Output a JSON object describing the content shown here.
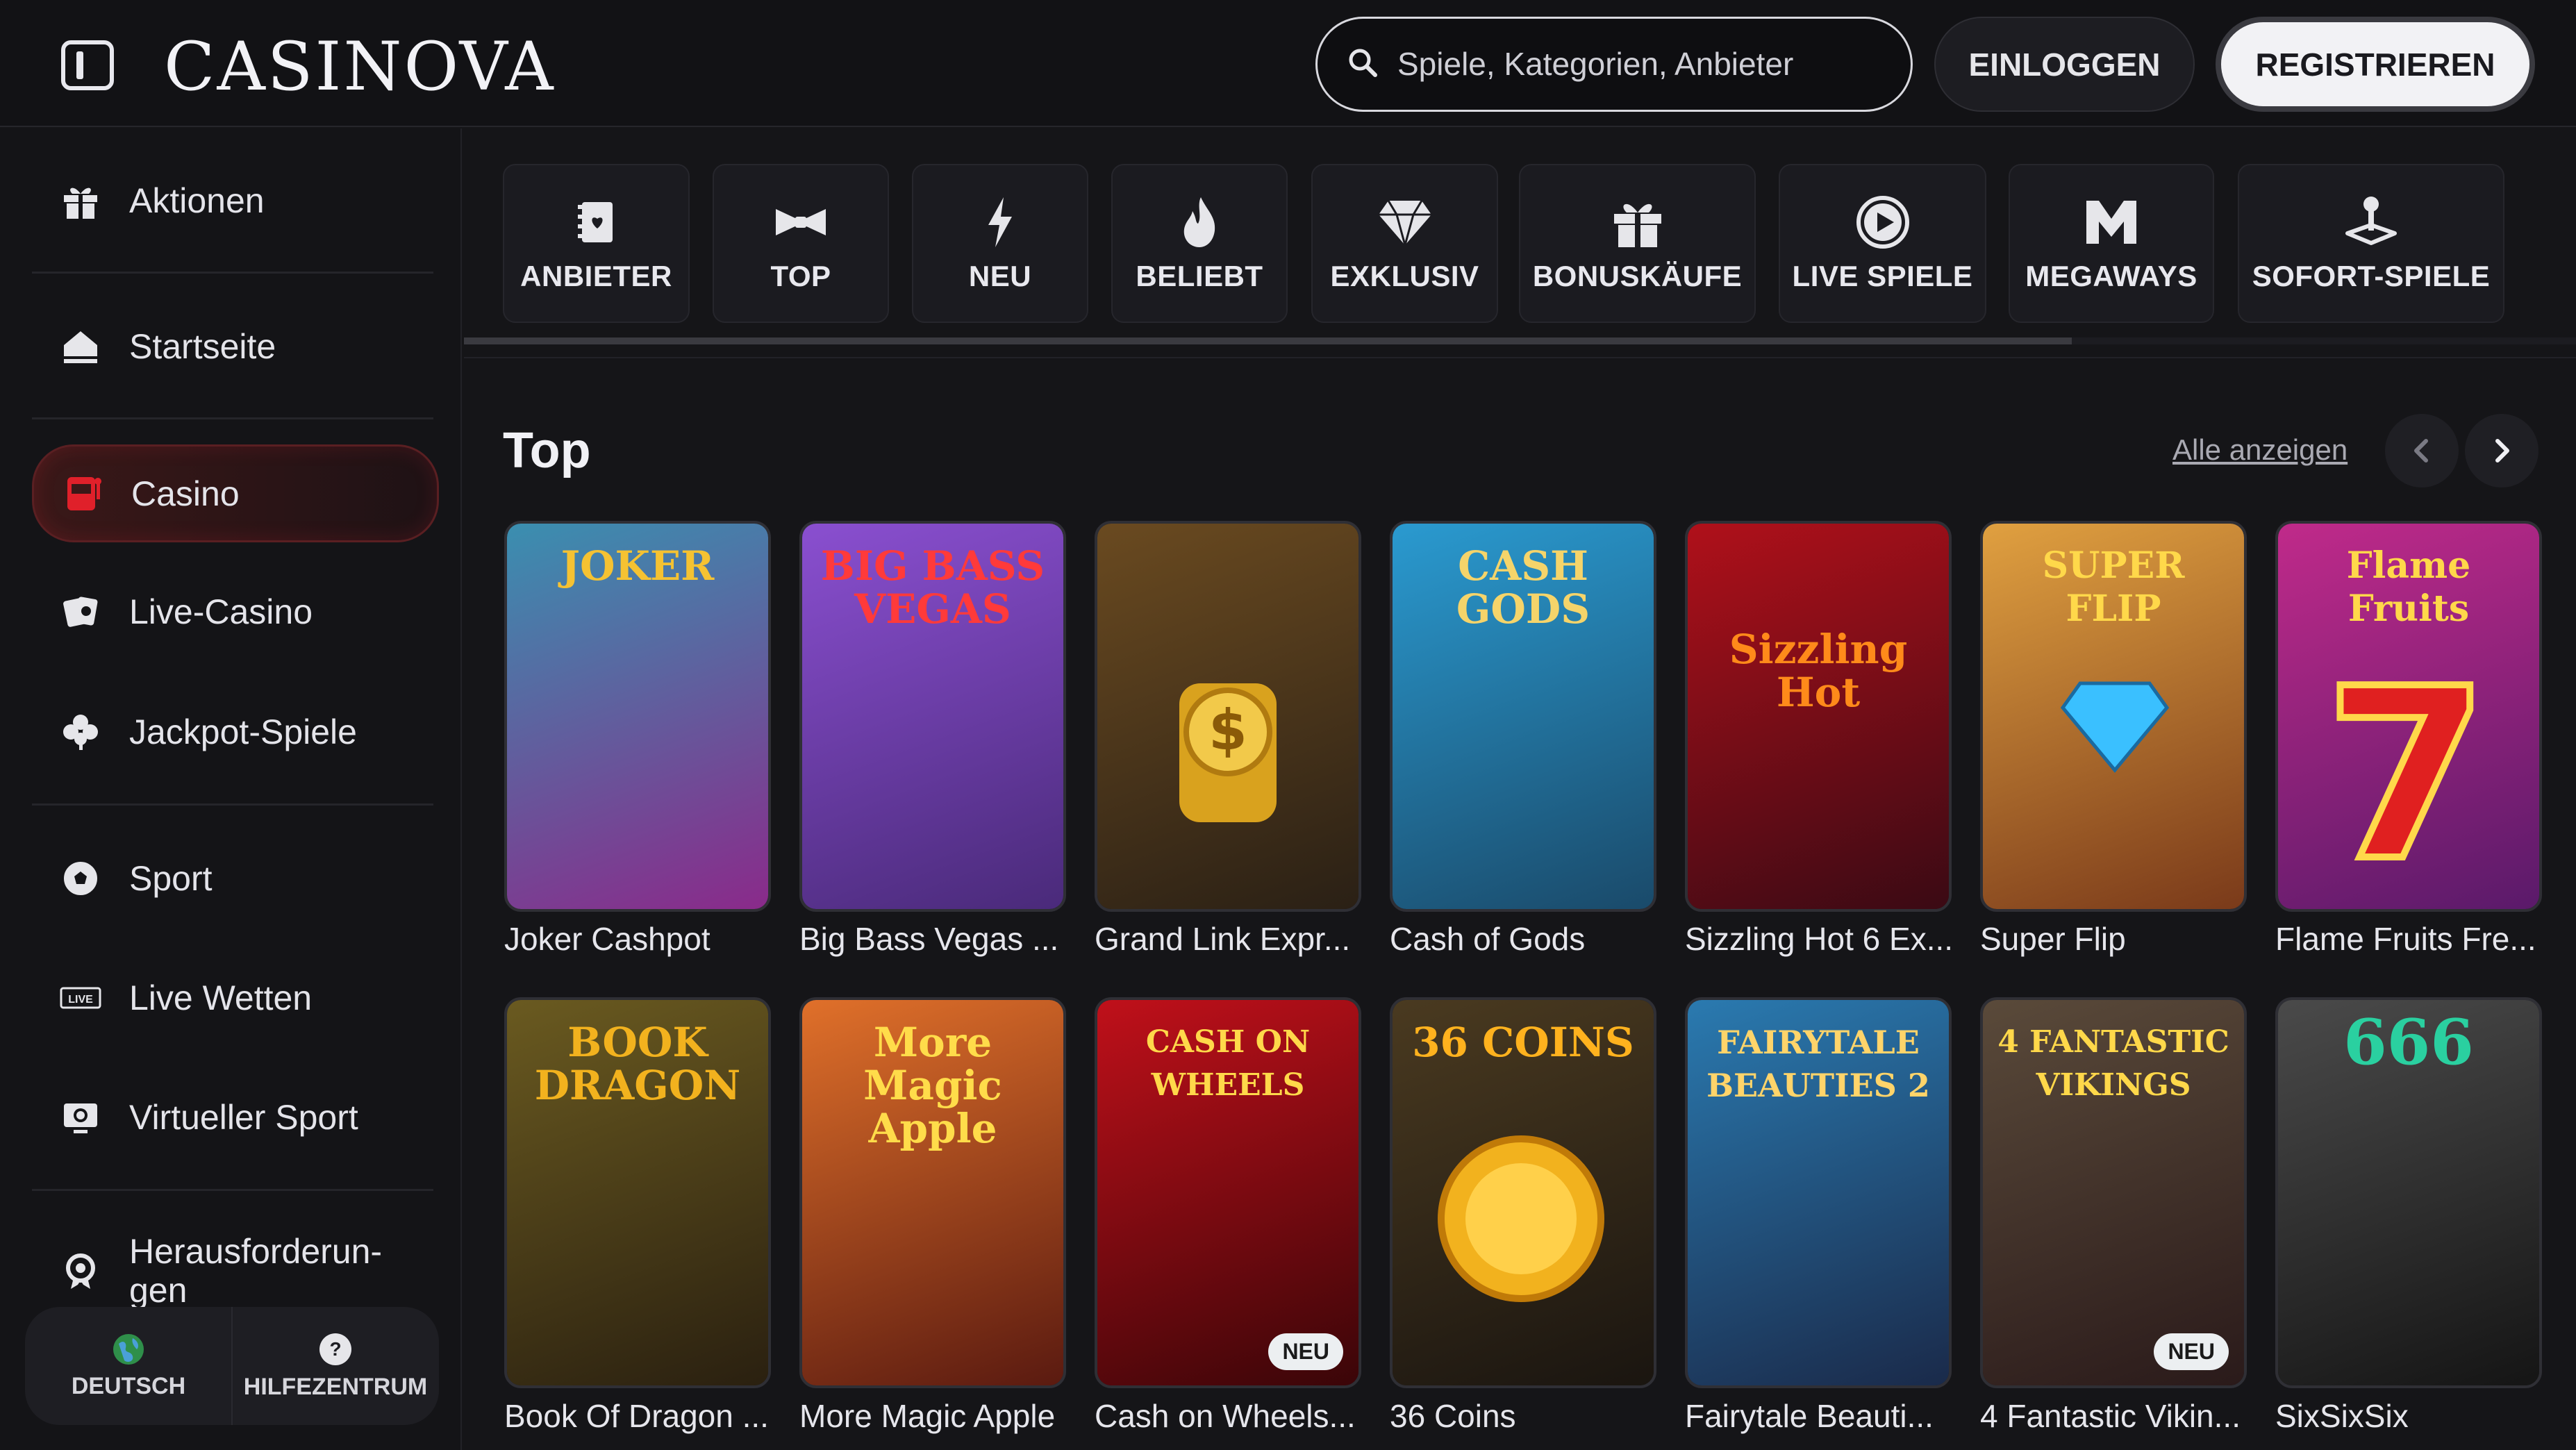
{
  "header": {
    "logo": "CASINOVA",
    "search_placeholder": "Spiele, Kategorien, Anbieter",
    "login_label": "EINLOGGEN",
    "register_label": "REGISTRIEREN"
  },
  "sidebar": {
    "items": [
      {
        "label": "Aktionen",
        "icon": "gift-icon"
      },
      {
        "label": "Startseite",
        "icon": "home-icon"
      },
      {
        "label": "Casino",
        "icon": "slot-machine-icon",
        "active": true
      },
      {
        "label": "Live-Casino",
        "icon": "cards-icon"
      },
      {
        "label": "Jackpot-Spiele",
        "icon": "clover-icon"
      },
      {
        "label": "Sport",
        "icon": "soccer-ball-icon"
      },
      {
        "label": "Live Wetten",
        "icon": "live-icon"
      },
      {
        "label": "Virtueller Sport",
        "icon": "virtual-sport-icon"
      },
      {
        "label": "Herausforderun-\ngen",
        "icon": "medal-icon"
      }
    ],
    "bottom": {
      "language_label": "DEUTSCH",
      "help_label": "HILFEZENTRUM"
    }
  },
  "categories": [
    {
      "label": "ANBIETER",
      "icon": "provider-book-icon"
    },
    {
      "label": "TOP",
      "icon": "bow-tie-icon"
    },
    {
      "label": "NEU",
      "icon": "lightning-icon"
    },
    {
      "label": "BELIEBT",
      "icon": "flame-icon"
    },
    {
      "label": "EXKLUSIV",
      "icon": "diamond-icon"
    },
    {
      "label": "BONUSKÄUFE",
      "icon": "gift-box-icon"
    },
    {
      "label": "LIVE SPIELE",
      "icon": "play-circle-icon"
    },
    {
      "label": "MEGAWAYS",
      "icon": "megaways-m-icon"
    },
    {
      "label": "SOFORT-SPIELE",
      "icon": "joystick-icon"
    }
  ],
  "section": {
    "title": "Top",
    "see_all": "Alle anzeigen"
  },
  "games": [
    {
      "title": "Joker Cashpot",
      "art_text": "JOKER",
      "colors": [
        "#3a8fb0",
        "#8a2a8a"
      ],
      "badge": ""
    },
    {
      "title": "Big Bass Vegas ...",
      "art_text": "BIG BASS VEGAS",
      "colors": [
        "#8a4fd0",
        "#4a2a7a"
      ],
      "badge": ""
    },
    {
      "title": "Grand Link Expr...",
      "art_text": "",
      "colors": [
        "#6a4a20",
        "#2a2015"
      ],
      "badge": ""
    },
    {
      "title": "Cash of Gods",
      "art_text": "CASH GODS",
      "colors": [
        "#2a9ad0",
        "#1a4a6a"
      ],
      "badge": ""
    },
    {
      "title": "Sizzling Hot 6 Ex...",
      "art_text": "Sizzling Hot",
      "colors": [
        "#b0101a",
        "#3a0a14"
      ],
      "badge": ""
    },
    {
      "title": "Super Flip",
      "art_text": "SUPER FLIP",
      "colors": [
        "#e0a040",
        "#7a3a1a"
      ],
      "badge": ""
    },
    {
      "title": "Flame Fruits Fre...",
      "art_text": "Flame Fruits",
      "colors": [
        "#c02a8a",
        "#5a1a6a"
      ],
      "badge": ""
    },
    {
      "title": "Book Of Dragon ...",
      "art_text": "BOOK DRAGON",
      "colors": [
        "#6a5a20",
        "#2a2010"
      ],
      "badge": ""
    },
    {
      "title": "More Magic Apple",
      "art_text": "More Magic Apple",
      "colors": [
        "#e0702a",
        "#5a1a10"
      ],
      "badge": ""
    },
    {
      "title": "Cash on Wheels...",
      "art_text": "CASH ON WHEELS",
      "colors": [
        "#c0101a",
        "#3a0508"
      ],
      "badge": "NEU"
    },
    {
      "title": "36 Coins",
      "art_text": "36 COINS",
      "colors": [
        "#4a3a20",
        "#1a1510"
      ],
      "badge": ""
    },
    {
      "title": "Fairytale Beauti...",
      "art_text": "FAIRYTALE BEAUTIES 2",
      "colors": [
        "#2a7ab0",
        "#1a2a4a"
      ],
      "badge": ""
    },
    {
      "title": "4 Fantastic Vikin...",
      "art_text": "4 FANTASTIC VIKINGS",
      "colors": [
        "#5a4a3a",
        "#2a1a1a"
      ],
      "badge": "NEU"
    },
    {
      "title": "SixSixSix",
      "art_text": "666",
      "colors": [
        "#4a4a4a",
        "#151515"
      ],
      "badge": ""
    }
  ],
  "theme": {
    "accent_red": "#e0202a",
    "background": "#151518"
  }
}
